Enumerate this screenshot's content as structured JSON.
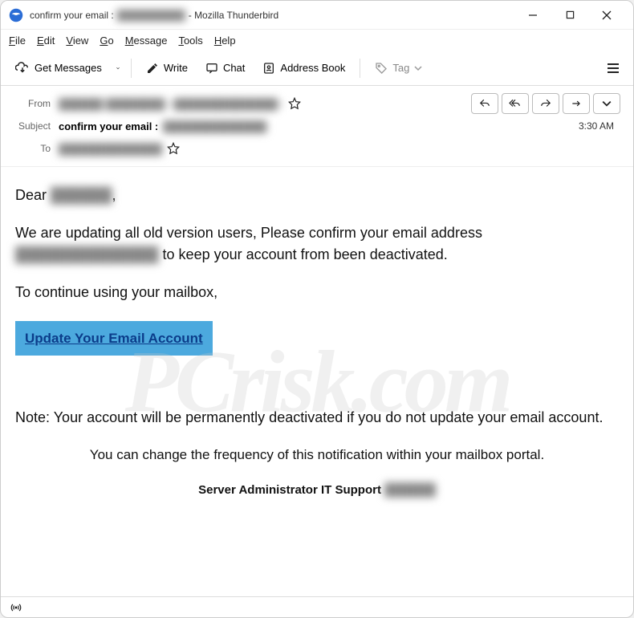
{
  "titlebar": {
    "title_prefix": "confirm your email :",
    "title_redacted": "██████████",
    "title_suffix": "- Mozilla Thunderbird"
  },
  "menubar": {
    "file": "File",
    "edit": "Edit",
    "view": "View",
    "go": "Go",
    "message": "Message",
    "tools": "Tools",
    "help": "Help"
  },
  "toolbar": {
    "get_messages": "Get Messages",
    "write": "Write",
    "chat": "Chat",
    "address_book": "Address Book",
    "tag": "Tag"
  },
  "headers": {
    "from_label": "From",
    "from_value_redacted": "██████ ████████ <██████████████>",
    "subject_label": "Subject",
    "subject_prefix": "confirm your email :",
    "subject_redacted": "██████████████",
    "to_label": "To",
    "to_value_redacted": "██████████████",
    "time": "3:30 AM"
  },
  "body": {
    "greeting_prefix": "Dear ",
    "greeting_name_redacted": "██████",
    "greeting_suffix": ",",
    "p1_a": "We are updating all old version users, Please confirm your email address ",
    "p1_redacted": "██████████████",
    "p1_b": " to keep your account from been deactivated.",
    "p2": "To continue using your mailbox,",
    "link": "Update Your Email Account",
    "note": "Note: Your account will be permanently deactivated if you do not update your email account.",
    "freq": "You can change the frequency of this notification within your mailbox portal.",
    "sig_a": "Server Administrator IT Support ",
    "sig_redacted": "██████"
  },
  "watermark": "PCrisk.com"
}
